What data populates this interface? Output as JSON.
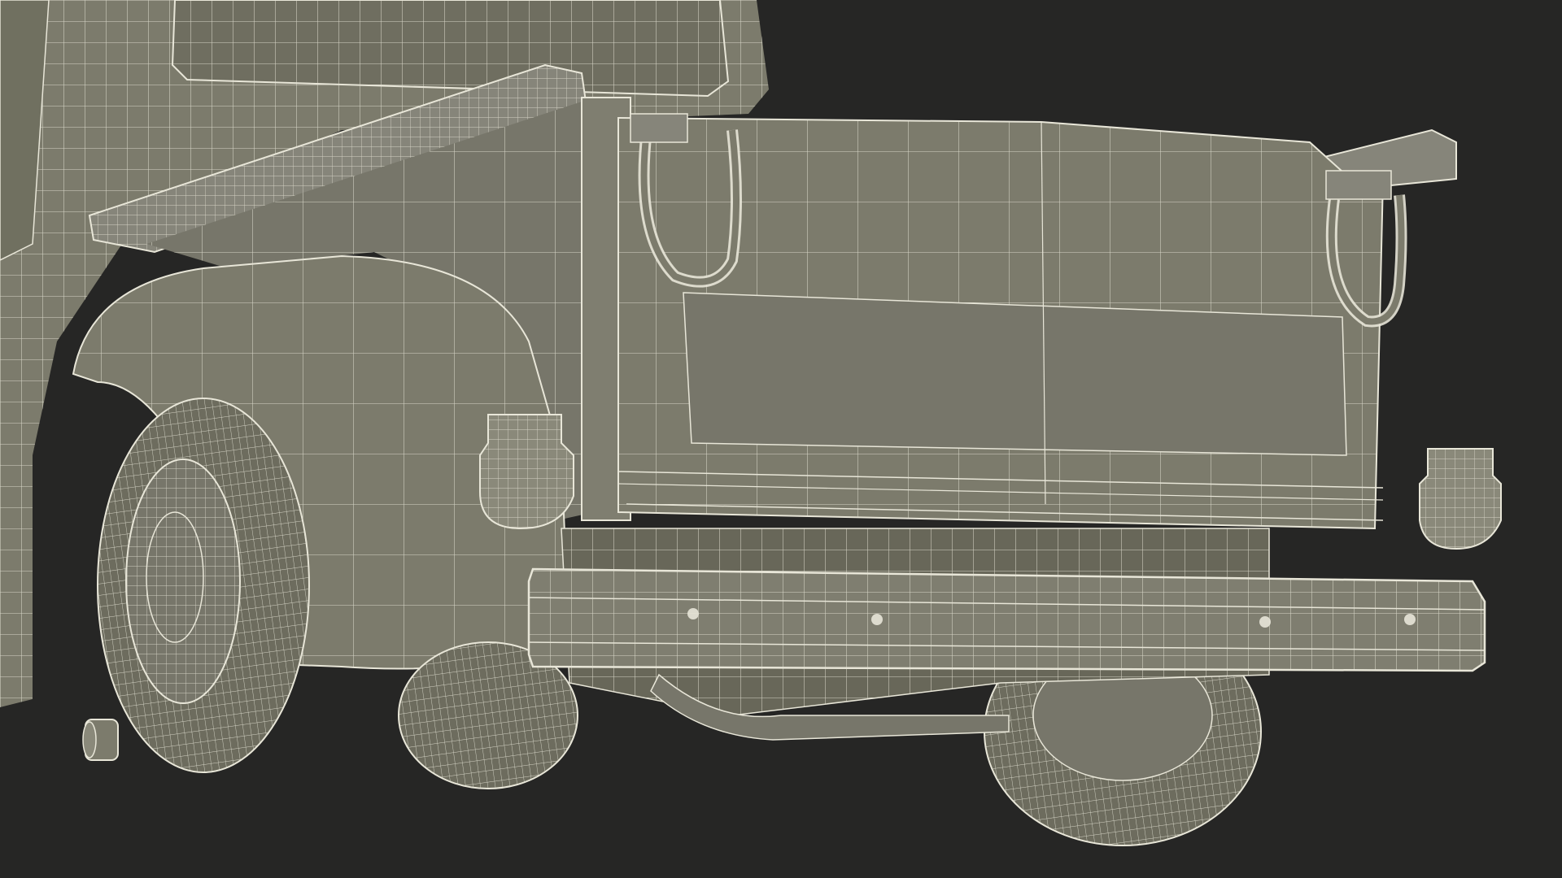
{
  "scene": {
    "subject": "pickup-truck-rear-wireframe",
    "colors": {
      "background": "#262625",
      "surface": "#7c7b6c",
      "surface_dark": "#6d6c5e",
      "surface_light": "#8a897a",
      "wire": "#e8e6d8",
      "shadow": "#1d1d1c"
    },
    "parts": [
      "cab",
      "bed-rail",
      "bed-side",
      "fender",
      "rear-tire-left",
      "rear-tire-right",
      "tailgate",
      "tailgate-chain-left",
      "tailgate-chain-right",
      "tail-light-left",
      "tail-light-right",
      "rear-bumper",
      "bumper-bolts",
      "exhaust-pipe",
      "chassis-underside"
    ]
  }
}
